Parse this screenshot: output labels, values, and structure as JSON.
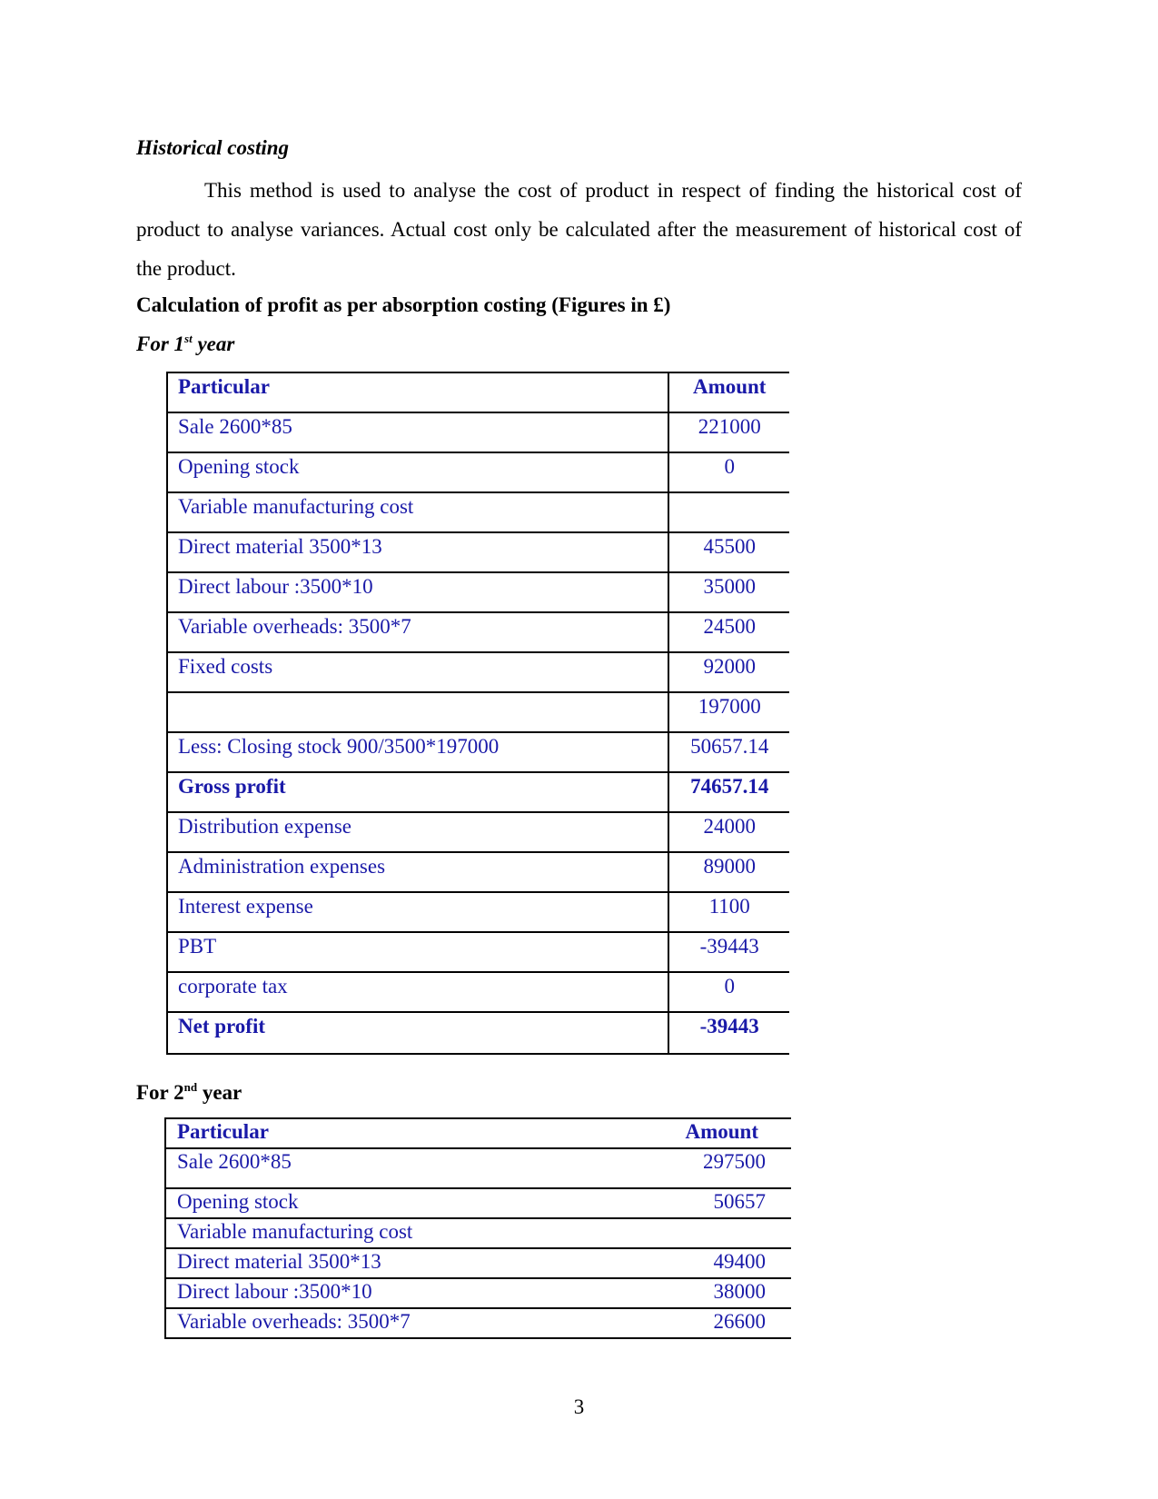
{
  "document": {
    "section_heading": "Historical costing",
    "paragraph": "This method is used to analyse the cost of product in respect of finding the historical cost of product to analyse variances. Actual cost only be calculated after the measurement of historical cost of the product.",
    "calculation_title": "Calculation of profit as per absorption costing (Figures in £)",
    "year1_label": {
      "prefix": "For 1",
      "sup": "st",
      "suffix": " year"
    },
    "year2_label": {
      "prefix": "For 2",
      "sup": "nd",
      "suffix": " year"
    },
    "page_number": "3"
  },
  "table_year1": {
    "headers": {
      "particular": "Particular",
      "amount": "Amount"
    },
    "rows": [
      {
        "particular": "Sale 2600*85",
        "amount": "221000",
        "bold": false
      },
      {
        "particular": "Opening stock",
        "amount": "0",
        "bold": false
      },
      {
        "particular": "Variable manufacturing cost",
        "amount": "",
        "bold": false
      },
      {
        "particular": "Direct material 3500*13",
        "amount": "45500",
        "bold": false
      },
      {
        "particular": "Direct labour :3500*10",
        "amount": "35000",
        "bold": false
      },
      {
        "particular": "Variable overheads: 3500*7",
        "amount": "24500",
        "bold": false
      },
      {
        "particular": "Fixed costs",
        "amount": "92000",
        "bold": false
      },
      {
        "particular": "",
        "amount": "197000",
        "bold": false
      },
      {
        "particular": "Less: Closing stock 900/3500*197000",
        "amount": "50657.14",
        "bold": false
      },
      {
        "particular": "Gross profit",
        "amount": "74657.14",
        "bold": true
      },
      {
        "particular": "Distribution expense",
        "amount": "24000",
        "bold": false
      },
      {
        "particular": "Administration expenses",
        "amount": "89000",
        "bold": false
      },
      {
        "particular": "Interest expense",
        "amount": "1100",
        "bold": false
      },
      {
        "particular": "PBT",
        "amount": "-39443",
        "bold": false
      },
      {
        "particular": "corporate tax",
        "amount": "0",
        "bold": false
      },
      {
        "particular": "Net profit",
        "amount": "-39443",
        "bold": true
      }
    ]
  },
  "table_year2": {
    "headers": {
      "particular": "Particular",
      "amount": "Amount"
    },
    "rows": [
      {
        "particular": "Sale 2600*85",
        "amount": "297500"
      },
      {
        "particular": "Opening stock",
        "amount": "50657"
      },
      {
        "particular": "Variable manufacturing cost",
        "amount": ""
      },
      {
        "particular": "Direct material 3500*13",
        "amount": "49400"
      },
      {
        "particular": "Direct labour :3500*10",
        "amount": "38000"
      },
      {
        "particular": "Variable overheads: 3500*7",
        "amount": "26600"
      }
    ]
  },
  "colors": {
    "table_text": "#1a1aa8",
    "body_text": "#000000",
    "rule": "#000000"
  }
}
